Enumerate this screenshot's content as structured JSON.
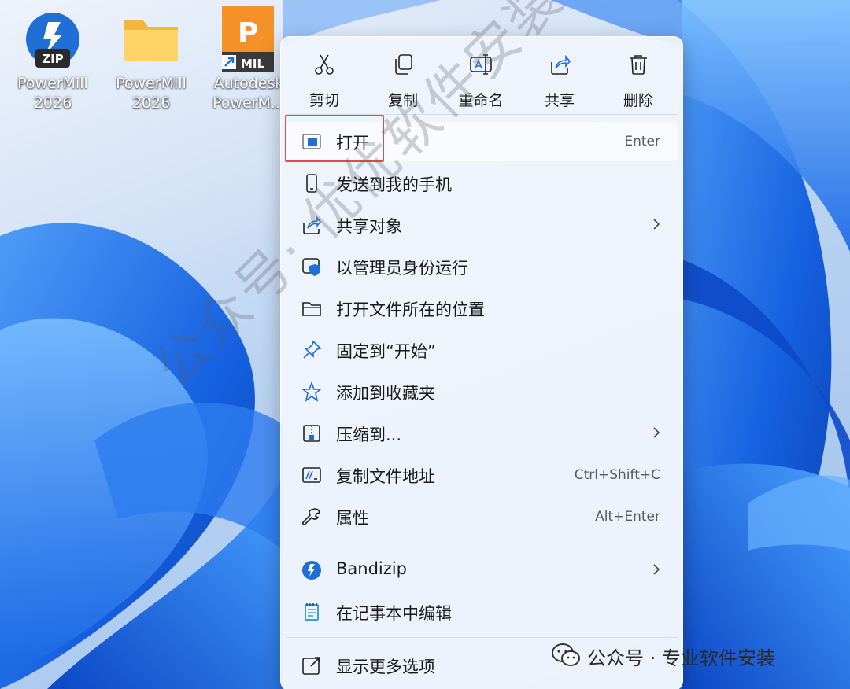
{
  "desktop": {
    "icons": [
      {
        "label": "PowerMill\n2026",
        "icon": "zip-archive-icon"
      },
      {
        "label": "PowerMill\n2026",
        "icon": "folder-icon"
      },
      {
        "label": "Autodesk\nPowerM...",
        "icon": "powermill-app-shortcut-icon",
        "badge": "MIL",
        "letter": "P"
      }
    ]
  },
  "context_menu": {
    "toolbar": [
      {
        "label": "剪切",
        "icon": "scissors-icon"
      },
      {
        "label": "复制",
        "icon": "copy-icon"
      },
      {
        "label": "重命名",
        "icon": "rename-icon"
      },
      {
        "label": "共享",
        "icon": "share-icon"
      },
      {
        "label": "删除",
        "icon": "trash-icon"
      }
    ],
    "items": [
      {
        "label": "打开",
        "shortcut": "Enter",
        "icon": "open-app-icon"
      },
      {
        "label": "发送到我的手机",
        "icon": "phone-icon"
      },
      {
        "label": "共享对象",
        "icon": "share-icon",
        "submenu": true
      },
      {
        "label": "以管理员身份运行",
        "icon": "shield-admin-icon"
      },
      {
        "label": "打开文件所在的位置",
        "icon": "folder-outline-icon"
      },
      {
        "label": "固定到“开始”",
        "icon": "pin-icon"
      },
      {
        "label": "添加到收藏夹",
        "icon": "star-icon"
      },
      {
        "label": "压缩到...",
        "icon": "compress-icon",
        "submenu": true
      },
      {
        "label": "复制文件地址",
        "shortcut": "Ctrl+Shift+C",
        "icon": "copy-path-icon"
      },
      {
        "label": "属性",
        "shortcut": "Alt+Enter",
        "icon": "wrench-icon"
      },
      {
        "label": "Bandizip",
        "icon": "bandizip-icon",
        "submenu": true
      },
      {
        "label": "在记事本中编辑",
        "icon": "notepad-icon"
      },
      {
        "label": "显示更多选项",
        "icon": "show-more-icon"
      }
    ]
  },
  "watermark": {
    "diagonal": "公众号· 优优软件安装",
    "corner": "公众号 · 专业软件安装"
  },
  "colors": {
    "highlight_box": "#e34a4a",
    "accent": "#1f6fd6"
  }
}
